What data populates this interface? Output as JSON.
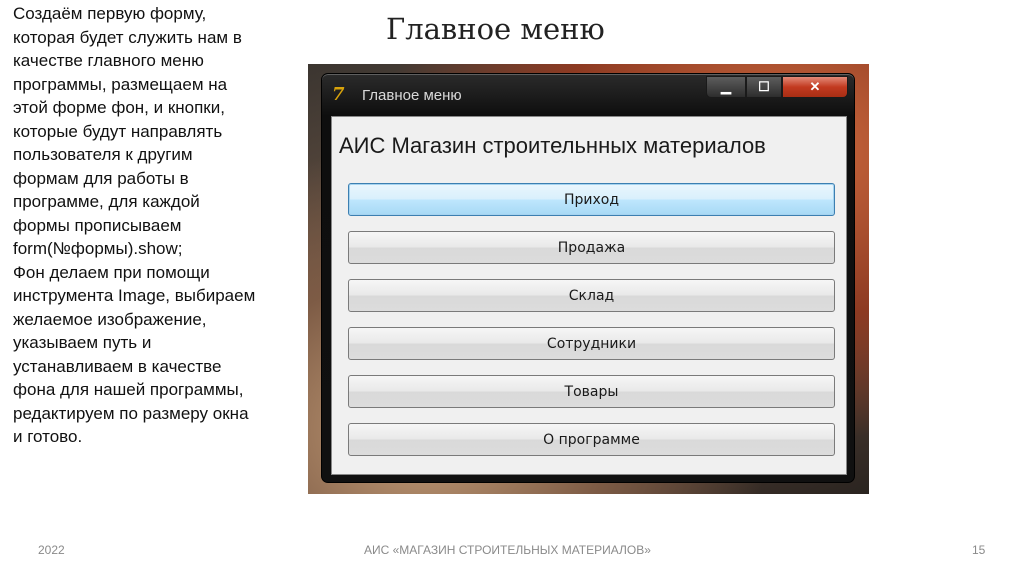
{
  "slide": {
    "description": "Создаём первую форму,\nкоторая будет служить нам в\nкачестве главного меню\nпрограммы, размещаем на\nэтой форме фон, и кнопки,\nкоторые будут направлять\nпользователя к другим\nформам для работы в\nпрограмме, для каждой\nформы прописываем\nform(№формы).show;\nФон делаем при помощи\nинструмента Image, выбираем\nжелаемое изображение,\nуказываем путь и\nустанавливаем в качестве\nфона для нашей программы,\nредактируем по размеру окна\nи готово.",
    "title": "Главное меню"
  },
  "window": {
    "icon": "7",
    "title": "Главное меню",
    "controls": {
      "minimize": "▁",
      "maximize": "☐",
      "close": "✕"
    },
    "app_heading": "АИС Магазин строительнных материалов",
    "buttons": [
      "Приход",
      "Продажа",
      "Склад",
      "Сотрудники",
      "Товары",
      "О программе"
    ]
  },
  "footer": {
    "year": "2022",
    "center": "АИС «МАГАЗИН СТРОИТЕЛЬНЫХ МАТЕРИАЛОВ»",
    "page": "15"
  },
  "icons": {
    "app_icon": "delphi-7-icon",
    "minimize": "minimize-icon",
    "maximize": "maximize-icon",
    "close": "close-icon"
  }
}
